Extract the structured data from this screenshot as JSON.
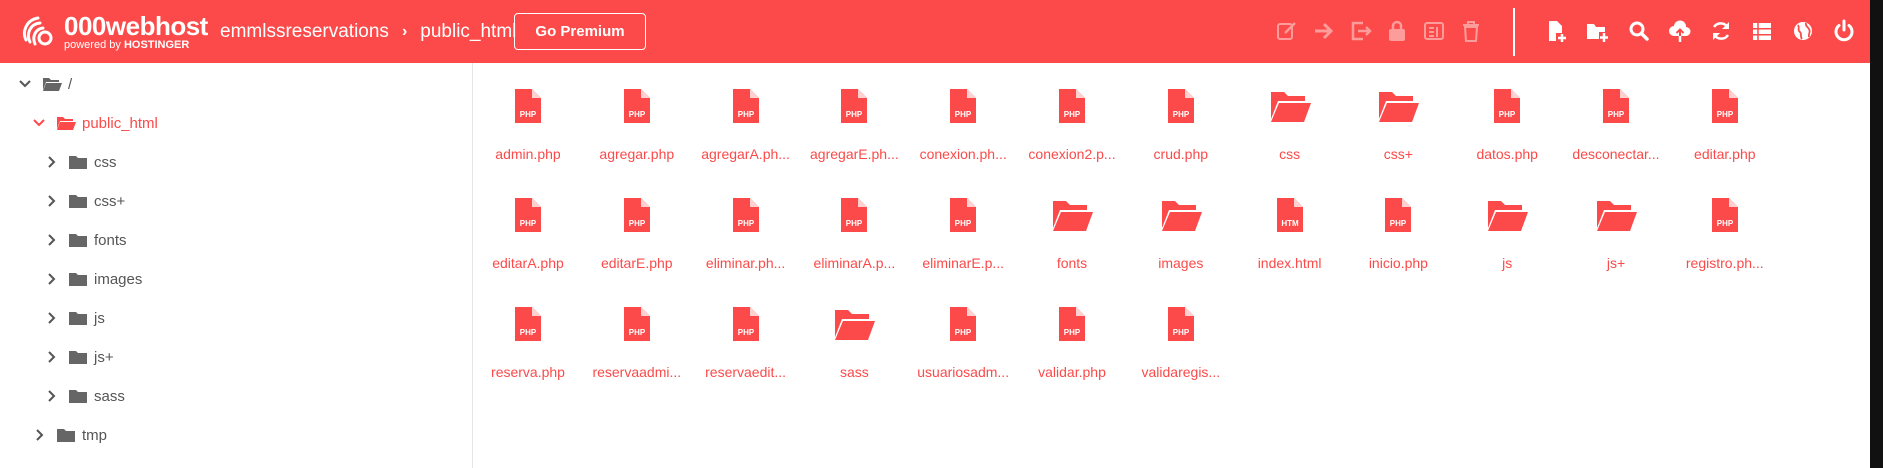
{
  "header": {
    "brand": "000webhost",
    "brand_sub_prefix": "powered by",
    "brand_sub_name": "HOSTINGER",
    "breadcrumb": [
      "emmlssreservations",
      "public_html"
    ],
    "premium_label": "Go Premium",
    "tools_left": [
      "rename-icon",
      "move-icon",
      "export-icon",
      "lock-icon",
      "archive-icon",
      "delete-icon"
    ],
    "tools_right": [
      "new-file-icon",
      "new-folder-icon",
      "search-icon",
      "upload-icon",
      "refresh-icon",
      "list-view-icon",
      "globe-icon",
      "power-icon"
    ],
    "accent": "#fb4a49"
  },
  "sidebar": {
    "root_label": "/",
    "items": [
      {
        "label": "public_html",
        "level": 1,
        "expanded": true,
        "active": true
      },
      {
        "label": "css",
        "level": 2
      },
      {
        "label": "css+",
        "level": 2
      },
      {
        "label": "fonts",
        "level": 2
      },
      {
        "label": "images",
        "level": 2
      },
      {
        "label": "js",
        "level": 2
      },
      {
        "label": "js+",
        "level": 2
      },
      {
        "label": "sass",
        "level": 2
      },
      {
        "label": "tmp",
        "level": 1
      }
    ]
  },
  "files": [
    {
      "name": "admin.php",
      "type": "php",
      "badge": "PHP"
    },
    {
      "name": "agregar.php",
      "type": "php",
      "badge": "PHP"
    },
    {
      "name": "agregarA.ph...",
      "type": "php",
      "badge": "PHP"
    },
    {
      "name": "agregarE.ph...",
      "type": "php",
      "badge": "PHP"
    },
    {
      "name": "conexion.ph...",
      "type": "php",
      "badge": "PHP"
    },
    {
      "name": "conexion2.p...",
      "type": "php",
      "badge": "PHP"
    },
    {
      "name": "crud.php",
      "type": "php",
      "badge": "PHP"
    },
    {
      "name": "css",
      "type": "folder"
    },
    {
      "name": "css+",
      "type": "folder"
    },
    {
      "name": "datos.php",
      "type": "php",
      "badge": "PHP"
    },
    {
      "name": "desconectar...",
      "type": "php",
      "badge": "PHP"
    },
    {
      "name": "editar.php",
      "type": "php",
      "badge": "PHP"
    },
    {
      "name": "editarA.php",
      "type": "php",
      "badge": "PHP"
    },
    {
      "name": "editarE.php",
      "type": "php",
      "badge": "PHP"
    },
    {
      "name": "eliminar.ph...",
      "type": "php",
      "badge": "PHP"
    },
    {
      "name": "eliminarA.p...",
      "type": "php",
      "badge": "PHP"
    },
    {
      "name": "eliminarE.p...",
      "type": "php",
      "badge": "PHP"
    },
    {
      "name": "fonts",
      "type": "folder"
    },
    {
      "name": "images",
      "type": "folder"
    },
    {
      "name": "index.html",
      "type": "html",
      "badge": "HTM"
    },
    {
      "name": "inicio.php",
      "type": "php",
      "badge": "PHP"
    },
    {
      "name": "js",
      "type": "folder"
    },
    {
      "name": "js+",
      "type": "folder"
    },
    {
      "name": "registro.ph...",
      "type": "php",
      "badge": "PHP"
    },
    {
      "name": "reserva.php",
      "type": "php",
      "badge": "PHP"
    },
    {
      "name": "reservaadmi...",
      "type": "php",
      "badge": "PHP"
    },
    {
      "name": "reservaedit...",
      "type": "php",
      "badge": "PHP"
    },
    {
      "name": "sass",
      "type": "folder"
    },
    {
      "name": "usuariosadm...",
      "type": "php",
      "badge": "PHP"
    },
    {
      "name": "validar.php",
      "type": "php",
      "badge": "PHP"
    },
    {
      "name": "validaregis...",
      "type": "php",
      "badge": "PHP"
    }
  ]
}
